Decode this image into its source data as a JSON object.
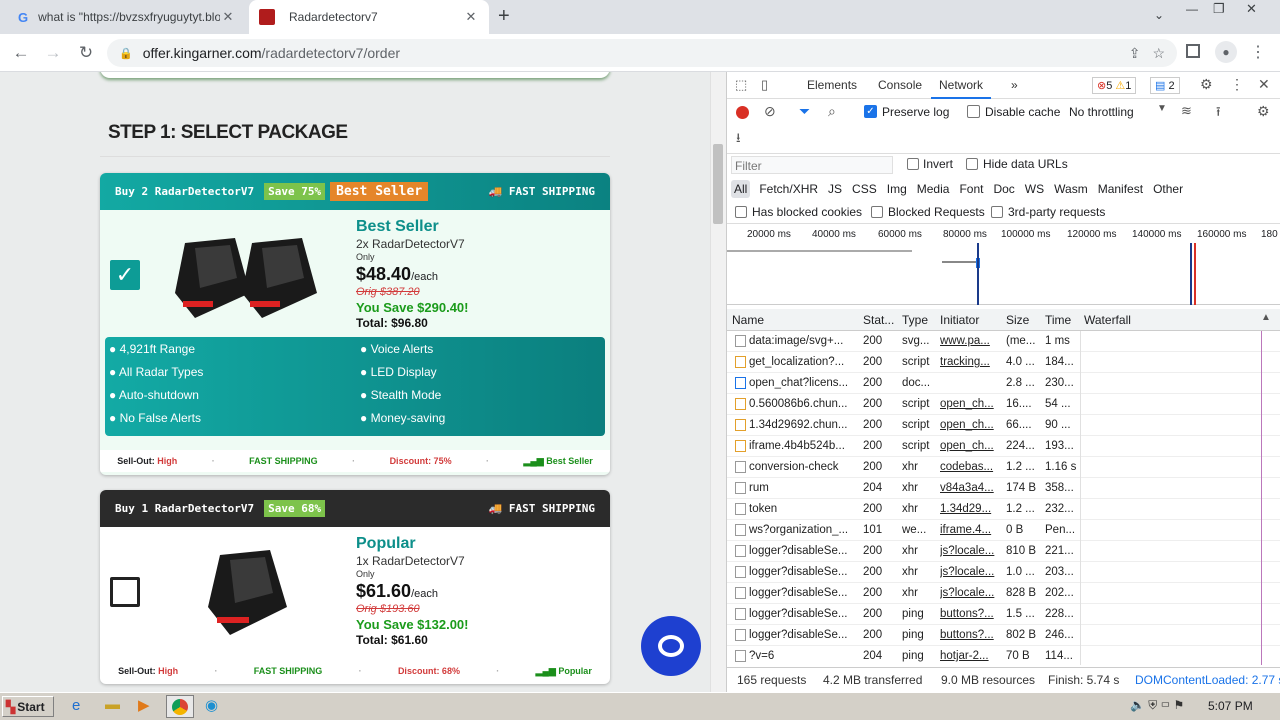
{
  "browser": {
    "tabs": [
      {
        "title": "what is \"https://bvzsxfryuguytyt.blo",
        "icon": "google-icon"
      },
      {
        "title": "Radardetectorv7",
        "icon": "site-icon"
      }
    ],
    "url_domain": "offer.kingarner.com",
    "url_path": "/radardetectorv7/order"
  },
  "page": {
    "step_title": "STEP 1: SELECT PACKAGE",
    "pkg1": {
      "head": "Buy 2 RadarDetectorV7",
      "save_badge": "Save 75%",
      "best_badge": "Best Seller",
      "shipping": "FAST SHIPPING",
      "name": "Best Seller",
      "qty": "2x RadarDetectorV7",
      "only": "Only",
      "price": "$48.40",
      "each": "/each",
      "orig": "Orig $387.20",
      "save": "You Save $290.40!",
      "total": "Total: $96.80",
      "features": [
        "4,921ft Range",
        "All Radar Types",
        "Auto-shutdown",
        "No False Alerts",
        "Voice Alerts",
        "LED Display",
        "Stealth Mode",
        "Money-saving"
      ],
      "foot_sellout": "Sell-Out:",
      "foot_sellout_val": "High",
      "foot_ship": "FAST SHIPPING",
      "foot_discount": "Discount: 75%",
      "foot_tag": "Best Seller"
    },
    "pkg2": {
      "head": "Buy 1 RadarDetectorV7",
      "save_badge": "Save 68%",
      "shipping": "FAST SHIPPING",
      "name": "Popular",
      "qty": "1x RadarDetectorV7",
      "only": "Only",
      "price": "$61.60",
      "each": "/each",
      "orig": "Orig $193.60",
      "save": "You Save $132.00!",
      "total": "Total: $61.60",
      "foot_sellout": "Sell-Out:",
      "foot_sellout_val": "High",
      "foot_ship": "FAST SHIPPING",
      "foot_discount": "Discount: 68%",
      "foot_tag": "Popular"
    }
  },
  "devtools": {
    "tabs": [
      "Elements",
      "Console",
      "Network"
    ],
    "errors": "5",
    "warnings": "1",
    "messages": "2",
    "preserve_log": "Preserve log",
    "disable_cache": "Disable cache",
    "throttling": "No throttling",
    "filter_placeholder": "Filter",
    "invert": "Invert",
    "hide_data_urls": "Hide data URLs",
    "types": [
      "All",
      "Fetch/XHR",
      "JS",
      "CSS",
      "Img",
      "Media",
      "Font",
      "Doc",
      "WS",
      "Wasm",
      "Manifest",
      "Other"
    ],
    "blocked_cookies": "Has blocked cookies",
    "blocked_requests": "Blocked Requests",
    "third_party": "3rd-party requests",
    "timeline": [
      "20000 ms",
      "40000 ms",
      "60000 ms",
      "80000 ms",
      "100000 ms",
      "120000 ms",
      "140000 ms",
      "160000 ms",
      "180"
    ],
    "columns": [
      "Name",
      "Stat...",
      "Type",
      "Initiator",
      "Size",
      "Time",
      "Waterfall"
    ],
    "rows": [
      [
        "data:image/svg+...",
        "200",
        "svg...",
        "www.pa...",
        "(me...",
        "1 ms"
      ],
      [
        "get_localization?...",
        "200",
        "script",
        "tracking...",
        "4.0 ...",
        "184..."
      ],
      [
        "open_chat?licens...",
        "200",
        "doc...",
        "",
        "2.8 ...",
        "230..."
      ],
      [
        "0.560086b6.chun...",
        "200",
        "script",
        "open_ch...",
        "16....",
        "54 ..."
      ],
      [
        "1.34d29692.chun...",
        "200",
        "script",
        "open_ch...",
        "66....",
        "90 ..."
      ],
      [
        "iframe.4b4b524b...",
        "200",
        "script",
        "open_ch...",
        "224...",
        "193..."
      ],
      [
        "conversion-check",
        "200",
        "xhr",
        "codebas...",
        "1.2 ...",
        "1.16 s"
      ],
      [
        "rum",
        "204",
        "xhr",
        "v84a3a4...",
        "174 B",
        "358..."
      ],
      [
        "token",
        "200",
        "xhr",
        "1.34d29...",
        "1.2 ...",
        "232..."
      ],
      [
        "ws?organization_...",
        "101",
        "we...",
        "iframe.4...",
        "0 B",
        "Pen..."
      ],
      [
        "logger?disableSe...",
        "200",
        "xhr",
        "js?locale...",
        "810 B",
        "221..."
      ],
      [
        "logger?disableSe...",
        "200",
        "xhr",
        "js?locale...",
        "1.0 ...",
        "203..."
      ],
      [
        "logger?disableSe...",
        "200",
        "xhr",
        "js?locale...",
        "828 B",
        "202..."
      ],
      [
        "logger?disableSe...",
        "200",
        "ping",
        "buttons?...",
        "1.5 ...",
        "228..."
      ],
      [
        "logger?disableSe...",
        "200",
        "ping",
        "buttons?...",
        "802 B",
        "246..."
      ],
      [
        "?v=6",
        "204",
        "ping",
        "hotjar-2...",
        "70 B",
        "114..."
      ]
    ],
    "status": {
      "requests": "165 requests",
      "transferred": "4.2 MB transferred",
      "resources": "9.0 MB resources",
      "finish": "Finish: 5.74 s",
      "dcl": "DOMContentLoaded: 2.77 s"
    }
  },
  "taskbar": {
    "start": "Start",
    "time": "5:07 PM"
  }
}
